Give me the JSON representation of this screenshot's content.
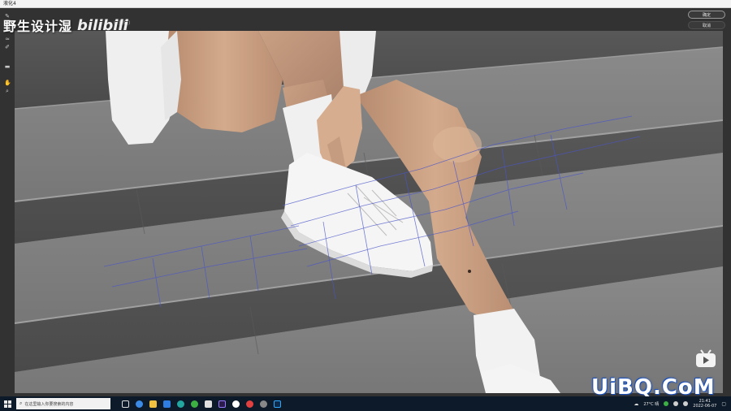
{
  "titlebar": {
    "title": "液化4"
  },
  "header": {
    "info_text": "(T拼缝)"
  },
  "actions": {
    "ok_label": "确定",
    "cancel_label": "取消"
  },
  "watermark": {
    "brand_text": "野生设计湿",
    "bili_text": "bilibili",
    "site_text": "UiBQ.CoM"
  },
  "tools": [
    {
      "name": "forward-warp-tool",
      "glyph": "✎"
    },
    {
      "name": "reconstruct-tool",
      "glyph": "⟲"
    },
    {
      "name": "smooth-tool",
      "glyph": "≈"
    },
    {
      "name": "freeze-mask-tool",
      "glyph": "✐"
    },
    {
      "name": "thaw-mask-tool",
      "glyph": "▬"
    },
    {
      "name": "hand-tool",
      "glyph": "✋"
    },
    {
      "name": "zoom-tool",
      "glyph": "⌕"
    }
  ],
  "taskbar": {
    "search_placeholder": "在这里输入你要搜索的内容",
    "weather": "27°C 晴",
    "time": "21:41",
    "date": "2022-06-07"
  },
  "colors": {
    "accent": "#2f6bd8",
    "mesh": "#4a55c8"
  }
}
